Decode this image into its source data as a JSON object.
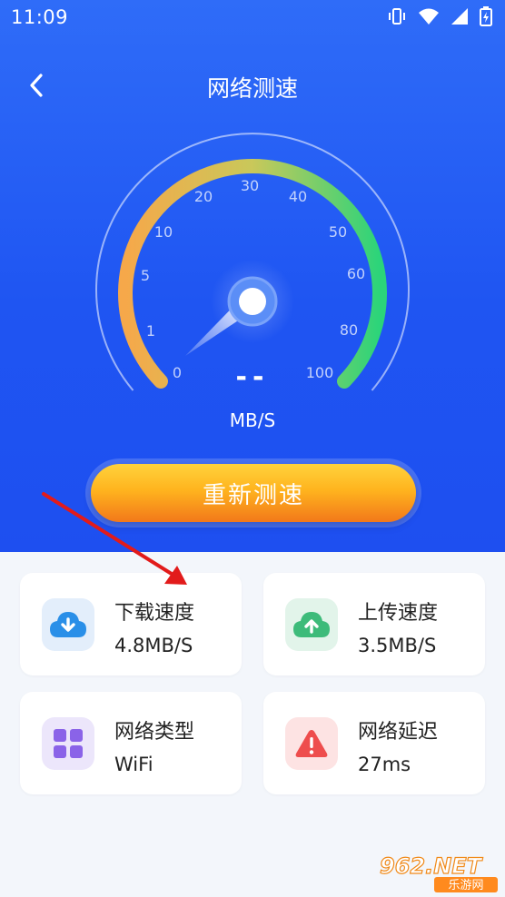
{
  "status_bar": {
    "time": "11:09"
  },
  "header": {
    "title": "网络测速"
  },
  "gauge": {
    "ticks": [
      "0",
      "1",
      "5",
      "10",
      "20",
      "30",
      "40",
      "50",
      "60",
      "80",
      "100"
    ],
    "value": "--",
    "unit": "MB/S"
  },
  "retest_label": "重新测速",
  "stats": [
    {
      "label": "下载速度",
      "value": "4.8MB/S",
      "icon": "cloud-download-icon",
      "color": "#2a8fe8",
      "bg": "#e3eefb"
    },
    {
      "label": "上传速度",
      "value": "3.5MB/S",
      "icon": "cloud-upload-icon",
      "color": "#3dbb7a",
      "bg": "#e2f4ea"
    },
    {
      "label": "网络类型",
      "value": "WiFi",
      "icon": "grid-icon",
      "color": "#8a63e8",
      "bg": "#ece6fb"
    },
    {
      "label": "网络延迟",
      "value": "27ms",
      "icon": "warning-icon",
      "color": "#ee4d4d",
      "bg": "#fde3e3"
    }
  ],
  "watermark": {
    "brand": "962.NET",
    "sub": "乐游网"
  }
}
